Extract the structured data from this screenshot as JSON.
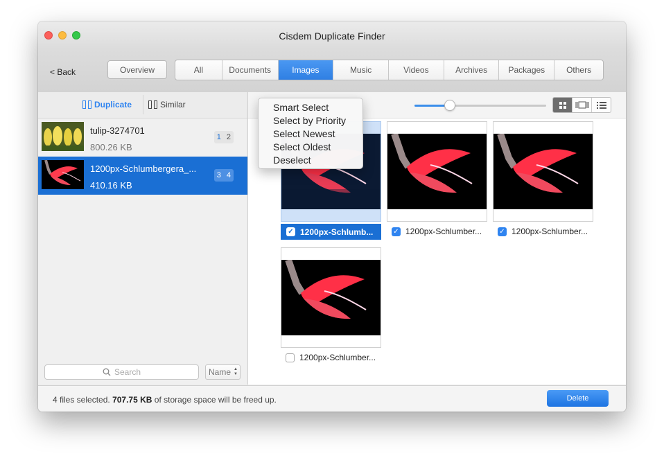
{
  "window": {
    "title": "Cisdem Duplicate Finder"
  },
  "toolbar": {
    "back_label": "< Back",
    "overview_label": "Overview",
    "tabs": [
      "All",
      "Documents",
      "Images",
      "Music",
      "Videos",
      "Archives",
      "Packages",
      "Others"
    ],
    "active_tab": "Images"
  },
  "sidebar": {
    "mode_duplicate": "Duplicate",
    "mode_similar": "Similar",
    "groups": [
      {
        "name": "tulip-3274701",
        "size": "800.26 KB",
        "count_a": "1",
        "count_b": "2"
      },
      {
        "name": "1200px-Schlumbergera_...",
        "size": "410.16 KB",
        "count_a": "3",
        "count_b": "4"
      }
    ],
    "search_placeholder": "Search",
    "sort_label": "Name"
  },
  "main": {
    "zoom_level": 0.27,
    "files": [
      {
        "name": "1200px-Schlumb...",
        "checked": true
      },
      {
        "name": "1200px-Schlumber...",
        "checked": true
      },
      {
        "name": "1200px-Schlumber...",
        "checked": true
      },
      {
        "name": "1200px-Schlumber...",
        "checked": false
      }
    ]
  },
  "select_menu": {
    "items": [
      "Smart Select",
      "Select by Priority",
      "Select Newest",
      "Select Oldest",
      "Deselect"
    ]
  },
  "status": {
    "count_text": "4 files selected.",
    "size": "707.75 KB",
    "suffix": "of storage space will be freed up.",
    "delete_label": "Delete"
  },
  "colors": {
    "accent": "#1a6fd4",
    "button_blue": "#2f84f0"
  },
  "icons": [
    "close-icon",
    "minimize-icon",
    "zoom-icon",
    "duplicate-mode-icon",
    "similar-mode-icon",
    "search-icon",
    "sort-arrows-icon",
    "grid-view-icon",
    "filmstrip-view-icon",
    "list-view-icon",
    "checkmark-icon"
  ]
}
